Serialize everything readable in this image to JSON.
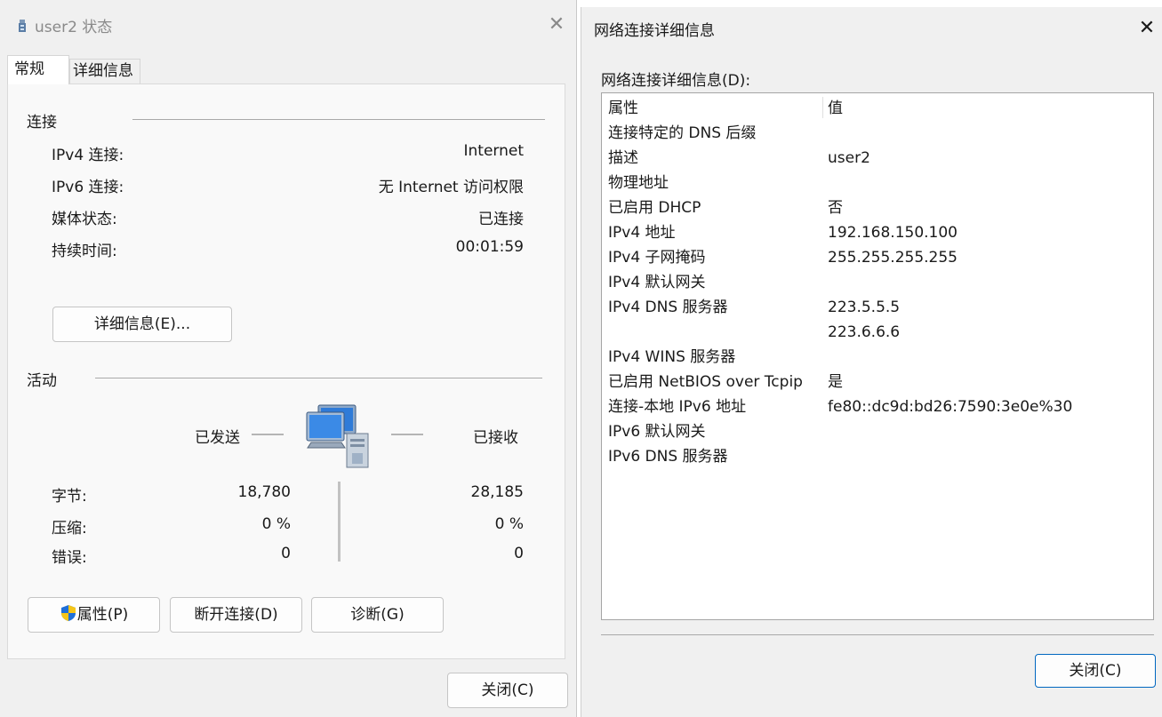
{
  "left_dialog": {
    "title": "user2 状态",
    "tabs": [
      "常规",
      "详细信息"
    ],
    "connection": {
      "section_title": "连接",
      "rows": [
        {
          "label": "IPv4 连接:",
          "value": "Internet"
        },
        {
          "label": "IPv6 连接:",
          "value": "无 Internet 访问权限"
        },
        {
          "label": "媒体状态:",
          "value": "已连接"
        },
        {
          "label": "持续时间:",
          "value": "00:01:59"
        }
      ],
      "details_button": "详细信息(E)..."
    },
    "activity": {
      "section_title": "活动",
      "sent_label": "已发送",
      "received_label": "已接收",
      "rows": [
        {
          "label": "字节:",
          "sent": "18,780",
          "received": "28,185"
        },
        {
          "label": "压缩:",
          "sent": "0 %",
          "received": "0 %"
        },
        {
          "label": "错误:",
          "sent": "0",
          "received": "0"
        }
      ]
    },
    "buttons": {
      "properties": "属性(P)",
      "disconnect": "断开连接(D)",
      "diagnose": "诊断(G)",
      "close": "关闭(C)"
    }
  },
  "right_dialog": {
    "title": "网络连接详细信息",
    "list_label": "网络连接详细信息(D):",
    "columns": [
      "属性",
      "值"
    ],
    "rows": [
      {
        "name": "连接特定的 DNS 后缀",
        "value": ""
      },
      {
        "name": "描述",
        "value": "user2"
      },
      {
        "name": "物理地址",
        "value": ""
      },
      {
        "name": "已启用 DHCP",
        "value": "否"
      },
      {
        "name": "IPv4 地址",
        "value": "192.168.150.100"
      },
      {
        "name": "IPv4 子网掩码",
        "value": "255.255.255.255"
      },
      {
        "name": "IPv4 默认网关",
        "value": ""
      },
      {
        "name": "IPv4 DNS 服务器",
        "value": "223.5.5.5"
      },
      {
        "name": "",
        "value": "223.6.6.6"
      },
      {
        "name": "IPv4 WINS 服务器",
        "value": ""
      },
      {
        "name": "已启用 NetBIOS over Tcpip",
        "value": "是"
      },
      {
        "name": "连接-本地 IPv6 地址",
        "value": "fe80::dc9d:bd26:7590:3e0e%30"
      },
      {
        "name": "IPv6 默认网关",
        "value": ""
      },
      {
        "name": "IPv6 DNS 服务器",
        "value": ""
      }
    ],
    "close_button": "关闭(C)"
  },
  "icons": {
    "title_icon": "network-adapter-icon",
    "close": "close-icon",
    "activity": "network-computers-icon",
    "shield": "uac-shield-icon"
  },
  "colors": {
    "accent_border": "#0067c0",
    "shield_blue": "#1e6fd9",
    "shield_yellow": "#f5c518"
  }
}
